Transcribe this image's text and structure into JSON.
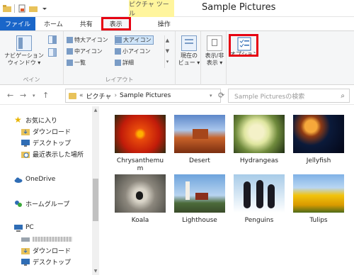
{
  "window": {
    "title": "Sample Pictures",
    "context_tab_header": "ピクチャ ツール"
  },
  "tabs": [
    {
      "label": "ファイル"
    },
    {
      "label": "ホーム"
    },
    {
      "label": "共有"
    },
    {
      "label": "表示",
      "highlighted": true
    },
    {
      "label": "操作"
    }
  ],
  "ribbon": {
    "pane_group": {
      "nav_pane_label": "ナビゲーション\nウィンドウ ▾",
      "group_label": "ペイン"
    },
    "layout_group": {
      "items": [
        {
          "label": "特大アイコン"
        },
        {
          "label": "大アイコン",
          "selected": true
        },
        {
          "label": "中アイコン"
        },
        {
          "label": "小アイコン"
        },
        {
          "label": "一覧"
        },
        {
          "label": "詳細"
        }
      ],
      "group_label": "レイアウト"
    },
    "current_view_label": "現在の\nビュー ▾",
    "show_hide_label": "表示/非\n表示 ▾",
    "options_label": "オプション",
    "accent_color": "#e60012"
  },
  "address": {
    "prefix": "«",
    "crumbs": [
      "ピクチャ",
      "Sample Pictures"
    ],
    "search_placeholder": "Sample Picturesの検索"
  },
  "nav_pane": {
    "items": [
      {
        "label": "お気に入り",
        "icon": "star-icon"
      },
      {
        "label": "ダウンロード",
        "icon": "download-folder-icon"
      },
      {
        "label": "デスクトップ",
        "icon": "desktop-icon"
      },
      {
        "label": "最近表示した場所",
        "icon": "recent-places-icon"
      },
      {
        "label": "OneDrive",
        "icon": "cloud-icon"
      },
      {
        "label": "ホームグループ",
        "icon": "homegroup-icon"
      },
      {
        "label": "PC",
        "icon": "pc-icon"
      },
      {
        "label": "ダウンロード",
        "icon": "download-folder-icon"
      },
      {
        "label": "デスクトップ",
        "icon": "desktop-icon"
      }
    ]
  },
  "files": [
    {
      "name": "Chrysanthemum"
    },
    {
      "name": "Desert"
    },
    {
      "name": "Hydrangeas"
    },
    {
      "name": "Jellyfish"
    },
    {
      "name": "Koala"
    },
    {
      "name": "Lighthouse"
    },
    {
      "name": "Penguins"
    },
    {
      "name": "Tulips"
    }
  ]
}
